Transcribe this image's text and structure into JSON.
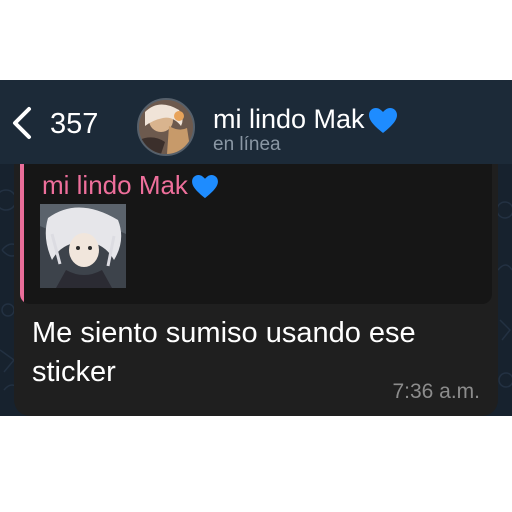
{
  "header": {
    "back_count": "357",
    "contact_name": "mi lindo Mak",
    "contact_status": "en línea",
    "heart_icon": "blue-heart-emoji"
  },
  "message": {
    "reply": {
      "author": "mi lindo Mak",
      "heart_icon": "blue-heart-emoji",
      "attachment": "sticker"
    },
    "text": "Me siento sumiso usando ese sticker",
    "time": "7:36 a.m."
  },
  "colors": {
    "header_bg": "#1c2a38",
    "chat_bg": "#17222e",
    "bubble_bg": "#1f1f1f",
    "reply_accent": "#ee6f9b",
    "heart": "#1e8cff"
  }
}
